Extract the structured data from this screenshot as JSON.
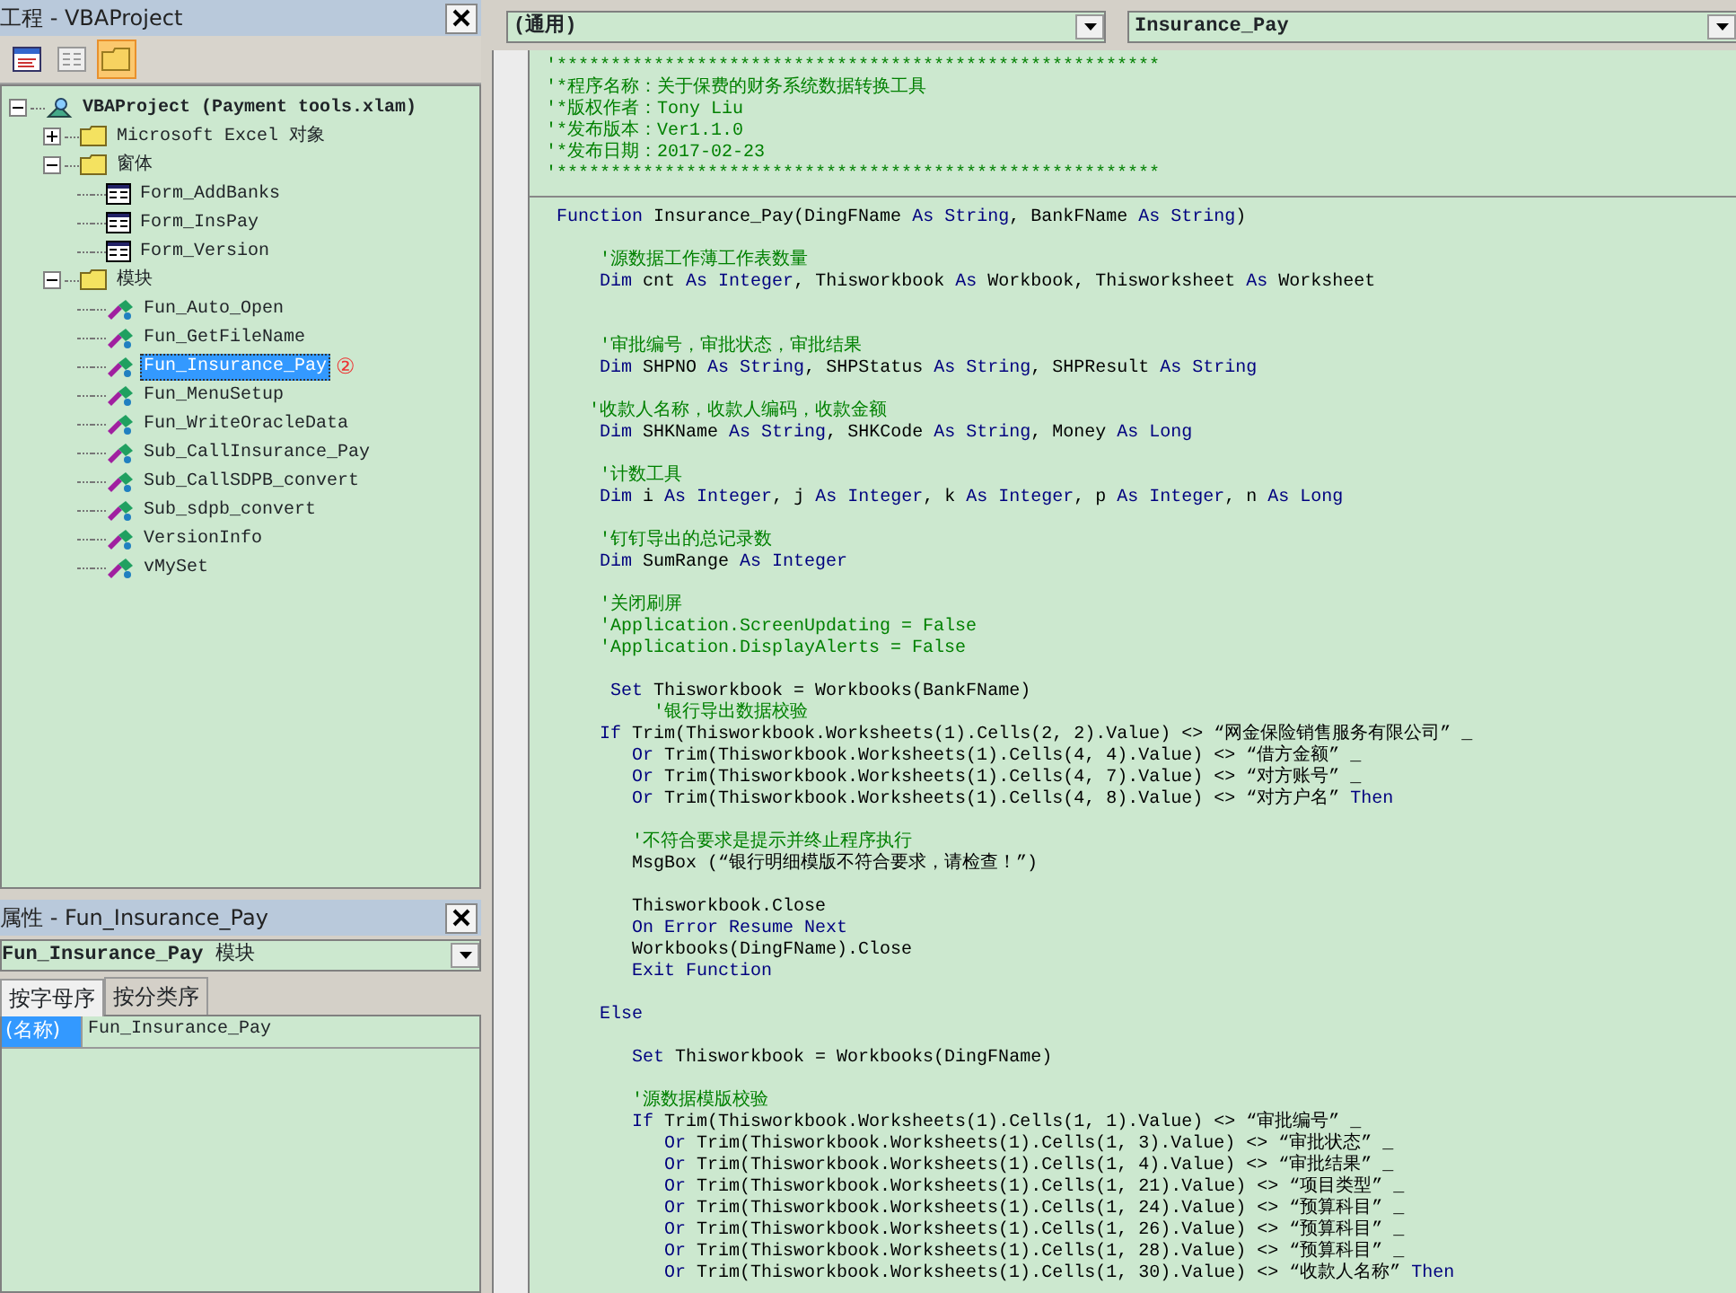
{
  "project_explorer": {
    "title": "工程 - VBAProject",
    "toolbar": [
      {
        "kind": "code",
        "selected": false
      },
      {
        "kind": "object",
        "selected": false
      },
      {
        "kind": "folders",
        "selected": true
      }
    ],
    "tree": [
      {
        "label": "VBAProject (Payment tools.xlam)",
        "kind": "project",
        "expanded": true,
        "selected": false,
        "children": [
          {
            "label": "Microsoft Excel 对象",
            "kind": "folder",
            "expanded": false,
            "selected": false
          },
          {
            "label": "窗体",
            "kind": "folder",
            "expanded": true,
            "selected": false,
            "children": [
              {
                "label": "Form_AddBanks",
                "kind": "form",
                "selected": false
              },
              {
                "label": "Form_InsPay",
                "kind": "form",
                "selected": false
              },
              {
                "label": "Form_Version",
                "kind": "form",
                "selected": false
              }
            ]
          },
          {
            "label": "模块",
            "kind": "folder",
            "expanded": true,
            "selected": false,
            "children": [
              {
                "label": "Fun_Auto_Open",
                "kind": "module",
                "selected": false
              },
              {
                "label": "Fun_GetFileName",
                "kind": "module",
                "selected": false
              },
              {
                "label": "Fun_Insurance_Pay",
                "kind": "module",
                "selected": true,
                "callout": "②"
              },
              {
                "label": "Fun_MenuSetup",
                "kind": "module",
                "selected": false
              },
              {
                "label": "Fun_WriteOracleData",
                "kind": "module",
                "selected": false
              },
              {
                "label": "Sub_CallInsurance_Pay",
                "kind": "module",
                "selected": false
              },
              {
                "label": "Sub_CallSDPB_convert",
                "kind": "module",
                "selected": false
              },
              {
                "label": "Sub_sdpb_convert",
                "kind": "module",
                "selected": false
              },
              {
                "label": "VersionInfo",
                "kind": "module",
                "selected": false
              },
              {
                "label": "vMySet",
                "kind": "module",
                "selected": false
              }
            ]
          }
        ]
      }
    ]
  },
  "properties": {
    "title": "属性 - Fun_Insurance_Pay",
    "object": "**Fun_Insurance_Pay** 模块",
    "tabs": [
      {
        "label": "按字母序",
        "selected": true
      },
      {
        "label": "按分类序",
        "selected": false
      }
    ],
    "rows": [
      {
        "name": "(名称)",
        "value": "Fun_Insurance_Pay",
        "selected": true
      }
    ]
  },
  "code_window": {
    "object_combo": "(通用)",
    "procedure_combo": "Insurance_Pay",
    "lines": [
      {
        "kind": "code",
        "segments": [
          {
            "kind": "comment",
            "text": "'********************************************************"
          }
        ]
      },
      {
        "kind": "code",
        "segments": [
          {
            "kind": "comment",
            "text": "'*程序名称：关于保费的财务系统数据转换工具"
          }
        ]
      },
      {
        "kind": "code",
        "segments": [
          {
            "kind": "comment",
            "text": "'*版权作者：Tony Liu"
          }
        ]
      },
      {
        "kind": "code",
        "segments": [
          {
            "kind": "comment",
            "text": "'*发布版本：Ver1.1.0"
          }
        ]
      },
      {
        "kind": "code",
        "segments": [
          {
            "kind": "comment",
            "text": "'*发布日期：2017-02-23"
          }
        ]
      },
      {
        "kind": "code",
        "segments": [
          {
            "kind": "comment",
            "text": "'********************************************************"
          }
        ]
      },
      {
        "kind": "separator"
      },
      {
        "kind": "code",
        "segments": [
          {
            "kind": "keyword",
            "text": " Function"
          },
          {
            "kind": "plain",
            "text": " Insurance_Pay(DingFName "
          },
          {
            "kind": "keyword",
            "text": "As String"
          },
          {
            "kind": "plain",
            "text": ", BankFName "
          },
          {
            "kind": "keyword",
            "text": "As String"
          },
          {
            "kind": "plain",
            "text": ")"
          }
        ]
      },
      {
        "kind": "blank"
      },
      {
        "kind": "code",
        "segments": [
          {
            "kind": "comment",
            "text": "     '源数据工作薄工作表数量"
          }
        ]
      },
      {
        "kind": "code",
        "segments": [
          {
            "kind": "keyword",
            "text": "     Dim"
          },
          {
            "kind": "plain",
            "text": " cnt "
          },
          {
            "kind": "keyword",
            "text": "As Integer"
          },
          {
            "kind": "plain",
            "text": ", Thisworkbook "
          },
          {
            "kind": "keyword",
            "text": "As"
          },
          {
            "kind": "plain",
            "text": " Workbook, Thisworksheet "
          },
          {
            "kind": "keyword",
            "text": "As"
          },
          {
            "kind": "plain",
            "text": " Worksheet"
          }
        ]
      },
      {
        "kind": "blank"
      },
      {
        "kind": "blank"
      },
      {
        "kind": "code",
        "segments": [
          {
            "kind": "comment",
            "text": "     '审批编号，审批状态，审批结果"
          }
        ]
      },
      {
        "kind": "code",
        "segments": [
          {
            "kind": "keyword",
            "text": "     Dim"
          },
          {
            "kind": "plain",
            "text": " SHPNO "
          },
          {
            "kind": "keyword",
            "text": "As String"
          },
          {
            "kind": "plain",
            "text": ", SHPStatus "
          },
          {
            "kind": "keyword",
            "text": "As String"
          },
          {
            "kind": "plain",
            "text": ", SHPResult "
          },
          {
            "kind": "keyword",
            "text": "As String"
          }
        ]
      },
      {
        "kind": "blank"
      },
      {
        "kind": "code",
        "segments": [
          {
            "kind": "comment",
            "text": "    '收款人名称，收款人编码，收款金额"
          }
        ]
      },
      {
        "kind": "code",
        "segments": [
          {
            "kind": "keyword",
            "text": "     Dim"
          },
          {
            "kind": "plain",
            "text": " SHKName "
          },
          {
            "kind": "keyword",
            "text": "As String"
          },
          {
            "kind": "plain",
            "text": ", SHKCode "
          },
          {
            "kind": "keyword",
            "text": "As String"
          },
          {
            "kind": "plain",
            "text": ", Money "
          },
          {
            "kind": "keyword",
            "text": "As Long"
          }
        ]
      },
      {
        "kind": "blank"
      },
      {
        "kind": "code",
        "segments": [
          {
            "kind": "comment",
            "text": "     '计数工具"
          }
        ]
      },
      {
        "kind": "code",
        "segments": [
          {
            "kind": "keyword",
            "text": "     Dim"
          },
          {
            "kind": "plain",
            "text": " i "
          },
          {
            "kind": "keyword",
            "text": "As Integer"
          },
          {
            "kind": "plain",
            "text": ", j "
          },
          {
            "kind": "keyword",
            "text": "As Integer"
          },
          {
            "kind": "plain",
            "text": ", k "
          },
          {
            "kind": "keyword",
            "text": "As Integer"
          },
          {
            "kind": "plain",
            "text": ", p "
          },
          {
            "kind": "keyword",
            "text": "As Integer"
          },
          {
            "kind": "plain",
            "text": ", n "
          },
          {
            "kind": "keyword",
            "text": "As Long"
          }
        ]
      },
      {
        "kind": "blank"
      },
      {
        "kind": "code",
        "segments": [
          {
            "kind": "comment",
            "text": "     '钉钉导出的总记录数"
          }
        ]
      },
      {
        "kind": "code",
        "segments": [
          {
            "kind": "keyword",
            "text": "     Dim"
          },
          {
            "kind": "plain",
            "text": " SumRange "
          },
          {
            "kind": "keyword",
            "text": "As Integer"
          }
        ]
      },
      {
        "kind": "blank"
      },
      {
        "kind": "code",
        "segments": [
          {
            "kind": "comment",
            "text": "     '关闭刷屏"
          }
        ]
      },
      {
        "kind": "code",
        "segments": [
          {
            "kind": "comment",
            "text": "     'Application.ScreenUpdating = False"
          }
        ]
      },
      {
        "kind": "code",
        "segments": [
          {
            "kind": "comment",
            "text": "     'Application.DisplayAlerts = False"
          }
        ]
      },
      {
        "kind": "blank"
      },
      {
        "kind": "code",
        "segments": [
          {
            "kind": "keyword",
            "text": "      Set"
          },
          {
            "kind": "plain",
            "text": " Thisworkbook = Workbooks(BankFName)"
          }
        ]
      },
      {
        "kind": "code",
        "segments": [
          {
            "kind": "comment",
            "text": "          '银行导出数据校验"
          }
        ]
      },
      {
        "kind": "code",
        "segments": [
          {
            "kind": "keyword",
            "text": "     If"
          },
          {
            "kind": "plain",
            "text": " Trim(Thisworkbook.Worksheets(1).Cells(2, 2).Value) <> “网金保险销售服务有限公司” _"
          }
        ]
      },
      {
        "kind": "code",
        "segments": [
          {
            "kind": "keyword",
            "text": "        Or"
          },
          {
            "kind": "plain",
            "text": " Trim(Thisworkbook.Worksheets(1).Cells(4, 4).Value) <> “借方金额” _"
          }
        ]
      },
      {
        "kind": "code",
        "segments": [
          {
            "kind": "keyword",
            "text": "        Or"
          },
          {
            "kind": "plain",
            "text": " Trim(Thisworkbook.Worksheets(1).Cells(4, 7).Value) <> “对方账号” _"
          }
        ]
      },
      {
        "kind": "code",
        "segments": [
          {
            "kind": "keyword",
            "text": "        Or"
          },
          {
            "kind": "plain",
            "text": " Trim(Thisworkbook.Worksheets(1).Cells(4, 8).Value) <> “对方户名” "
          },
          {
            "kind": "keyword",
            "text": "Then"
          }
        ]
      },
      {
        "kind": "blank"
      },
      {
        "kind": "code",
        "segments": [
          {
            "kind": "comment",
            "text": "        '不符合要求是提示并终止程序执行"
          }
        ]
      },
      {
        "kind": "code",
        "segments": [
          {
            "kind": "plain",
            "text": "        MsgBox (“银行明细模版不符合要求，请检查！”)"
          }
        ]
      },
      {
        "kind": "blank"
      },
      {
        "kind": "code",
        "segments": [
          {
            "kind": "plain",
            "text": "        Thisworkbook.Close"
          }
        ]
      },
      {
        "kind": "code",
        "segments": [
          {
            "kind": "keyword",
            "text": "        On Error Resume Next"
          }
        ]
      },
      {
        "kind": "code",
        "segments": [
          {
            "kind": "plain",
            "text": "        Workbooks(DingFName).Close"
          }
        ]
      },
      {
        "kind": "code",
        "segments": [
          {
            "kind": "keyword",
            "text": "        Exit Function"
          }
        ]
      },
      {
        "kind": "blank"
      },
      {
        "kind": "code",
        "segments": [
          {
            "kind": "keyword",
            "text": "     Else"
          }
        ]
      },
      {
        "kind": "blank"
      },
      {
        "kind": "code",
        "segments": [
          {
            "kind": "keyword",
            "text": "        Set"
          },
          {
            "kind": "plain",
            "text": " Thisworkbook = Workbooks(DingFName)"
          }
        ]
      },
      {
        "kind": "blank"
      },
      {
        "kind": "code",
        "segments": [
          {
            "kind": "comment",
            "text": "        '源数据模版校验"
          }
        ]
      },
      {
        "kind": "code",
        "segments": [
          {
            "kind": "keyword",
            "text": "        If"
          },
          {
            "kind": "plain",
            "text": " Trim(Thisworkbook.Worksheets(1).Cells(1, 1).Value) <> “审批编号” _"
          }
        ]
      },
      {
        "kind": "code",
        "segments": [
          {
            "kind": "keyword",
            "text": "           Or"
          },
          {
            "kind": "plain",
            "text": " Trim(Thisworkbook.Worksheets(1).Cells(1, 3).Value) <> “审批状态” _"
          }
        ]
      },
      {
        "kind": "code",
        "segments": [
          {
            "kind": "keyword",
            "text": "           Or"
          },
          {
            "kind": "plain",
            "text": " Trim(Thisworkbook.Worksheets(1).Cells(1, 4).Value) <> “审批结果” _"
          }
        ]
      },
      {
        "kind": "code",
        "segments": [
          {
            "kind": "keyword",
            "text": "           Or"
          },
          {
            "kind": "plain",
            "text": " Trim(Thisworkbook.Worksheets(1).Cells(1, 21).Value) <> “项目类型” _"
          }
        ]
      },
      {
        "kind": "code",
        "segments": [
          {
            "kind": "keyword",
            "text": "           Or"
          },
          {
            "kind": "plain",
            "text": " Trim(Thisworkbook.Worksheets(1).Cells(1, 24).Value) <> “预算科目” _"
          }
        ]
      },
      {
        "kind": "code",
        "segments": [
          {
            "kind": "keyword",
            "text": "           Or"
          },
          {
            "kind": "plain",
            "text": " Trim(Thisworkbook.Worksheets(1).Cells(1, 26).Value) <> “预算科目” _"
          }
        ]
      },
      {
        "kind": "code",
        "segments": [
          {
            "kind": "keyword",
            "text": "           Or"
          },
          {
            "kind": "plain",
            "text": " Trim(Thisworkbook.Worksheets(1).Cells(1, 28).Value) <> “预算科目” _"
          }
        ]
      },
      {
        "kind": "code",
        "segments": [
          {
            "kind": "keyword",
            "text": "           Or"
          },
          {
            "kind": "plain",
            "text": " Trim(Thisworkbook.Worksheets(1).Cells(1, 30).Value) <> “收款人名称” "
          },
          {
            "kind": "keyword",
            "text": "Then"
          }
        ]
      }
    ]
  }
}
